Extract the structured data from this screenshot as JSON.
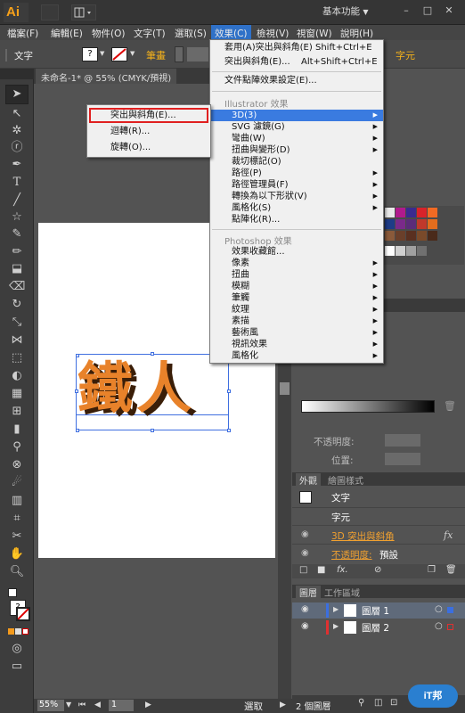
{
  "app": {
    "logo": "Ai",
    "workspace": "基本功能",
    "win_min": "–",
    "win_max": "□",
    "win_close": "✕"
  },
  "menubar": {
    "items": [
      "檔案(F)",
      "編輯(E)",
      "物件(O)",
      "文字(T)",
      "選取(S)",
      "效果(C)",
      "檢視(V)",
      "視窗(W)",
      "說明(H)"
    ]
  },
  "controlbar": {
    "tool_label": "文字",
    "stroke_label": "筆畫",
    "char_label": "字元",
    "fill_value": "?"
  },
  "document": {
    "tab_title": "未命名-1* @ 55% (CMYK/預視)",
    "zoom": "55%",
    "page": "1",
    "status": "選取",
    "artwork_text": "鐵人"
  },
  "effect_menu": {
    "apply_last": "套用(A)突出與斜角(E)",
    "apply_last_shortcut": "Shift+Ctrl+E",
    "last_effect": "突出與斜角(E)...",
    "last_effect_shortcut": "Alt+Shift+Ctrl+E",
    "doc_raster": "文件點陣效果設定(E)...",
    "illustrator_header": "Illustrator 效果",
    "illustrator_items": [
      "3D(3)",
      "SVG 濾鏡(G)",
      "彎曲(W)",
      "扭曲與變形(D)",
      "裁切標記(O)",
      "路徑(P)",
      "路徑管理員(F)",
      "轉換為以下形狀(V)",
      "風格化(S)",
      "點陣化(R)..."
    ],
    "photoshop_header": "Photoshop 效果",
    "photoshop_items": [
      "效果收藏館...",
      "像素",
      "扭曲",
      "模糊",
      "筆觸",
      "紋理",
      "素描",
      "藝術風",
      "視訊效果",
      "風格化"
    ]
  },
  "submenu_3d": {
    "items": [
      "突出與斜角(E)...",
      "迴轉(R)...",
      "旋轉(O)..."
    ]
  },
  "right_panels": {
    "transparency_label": "不透明度:",
    "position_label": "位置:",
    "appearance_tab": "外觀",
    "graphic_styles_tab": "繪圖樣式",
    "appearance_title": "文字",
    "appearance_char": "字元",
    "appearance_effect": "3D 突出與斜角",
    "appearance_opacity": "不透明度:",
    "appearance_opacity_value": "預設",
    "fx_label": "fx",
    "layers_tab": "圖層",
    "workspace_tab": "工作區域",
    "layers": [
      "圖層 1",
      "圖層 2"
    ],
    "layer_count": "2 個圖層"
  },
  "colors": {
    "menu_highlight": "#3a7be0",
    "menubar_active": "#2f71c8",
    "annotation_red": "#e02020",
    "extrude_orange": "#e8822a"
  }
}
